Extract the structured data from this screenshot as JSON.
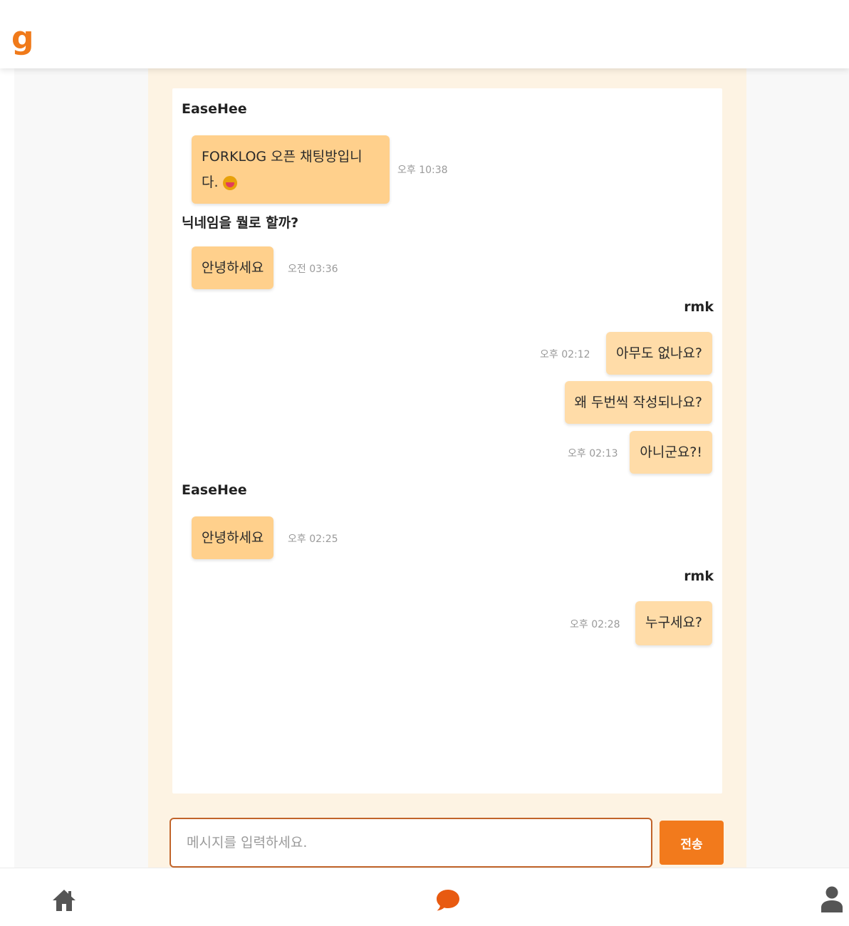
{
  "header": {
    "logo_text": "g"
  },
  "colors": {
    "accent": "#f27a1c",
    "bubble": "#ffd08c",
    "bubble_light": "#ffdca8",
    "chat_background": "#fdf3e3"
  },
  "chat": {
    "messages": [
      {
        "sender": "EaseHee",
        "text_line1": "FORKLOG 오픈 채팅방입니",
        "text_line2": "다.",
        "emoji": "grinning-face",
        "time": "오후 10:38"
      },
      {
        "sender": "닉네임을 뭘로 할까?",
        "text": "안녕하세요",
        "time": "오전 03:36"
      },
      {
        "sender": "rmk",
        "text": "아무도 없나요?",
        "time": "오후 02:12"
      },
      {
        "text": "왜 두번씩 작성되나요?"
      },
      {
        "text": "아니군요?!",
        "time": "오후 02:13"
      },
      {
        "sender": "EaseHee",
        "text": "안녕하세요",
        "time": "오후 02:25"
      },
      {
        "sender": "rmk",
        "text": "누구세요?",
        "time": "오후 02:28"
      }
    ]
  },
  "composer": {
    "placeholder": "메시지를 입력하세요.",
    "value": "",
    "send_label": "전송"
  },
  "bottom_nav": {
    "items": [
      {
        "icon": "home-icon"
      },
      {
        "icon": "chat-bubble-icon",
        "active": true
      },
      {
        "icon": "user-icon"
      }
    ]
  }
}
